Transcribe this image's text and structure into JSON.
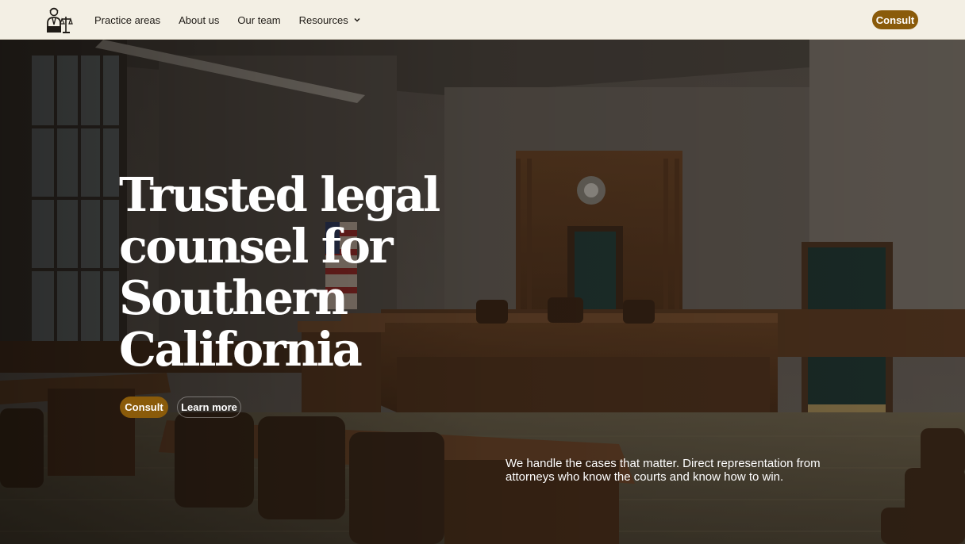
{
  "brand": {
    "logo_icon": "lawyer-with-scales-icon"
  },
  "nav": {
    "items": [
      {
        "label": "Practice areas"
      },
      {
        "label": "About us"
      },
      {
        "label": "Our team"
      },
      {
        "label": "Resources",
        "icon": "chevron-down-icon"
      }
    ],
    "consult_label": "Consult"
  },
  "hero": {
    "headline_lines": [
      "Trusted legal",
      "counsel for",
      "Southern",
      "California"
    ],
    "primary_cta": "Consult",
    "secondary_cta": "Learn more",
    "tagline_lines": [
      "We handle the cases that matter. Direct representation from",
      "attorneys who know the courts and know how to win."
    ]
  },
  "colors": {
    "header_bg": "#f3efe4",
    "accent": "#8a5b0a",
    "text_dark": "#1f1b16",
    "text_light": "#ffffff"
  }
}
